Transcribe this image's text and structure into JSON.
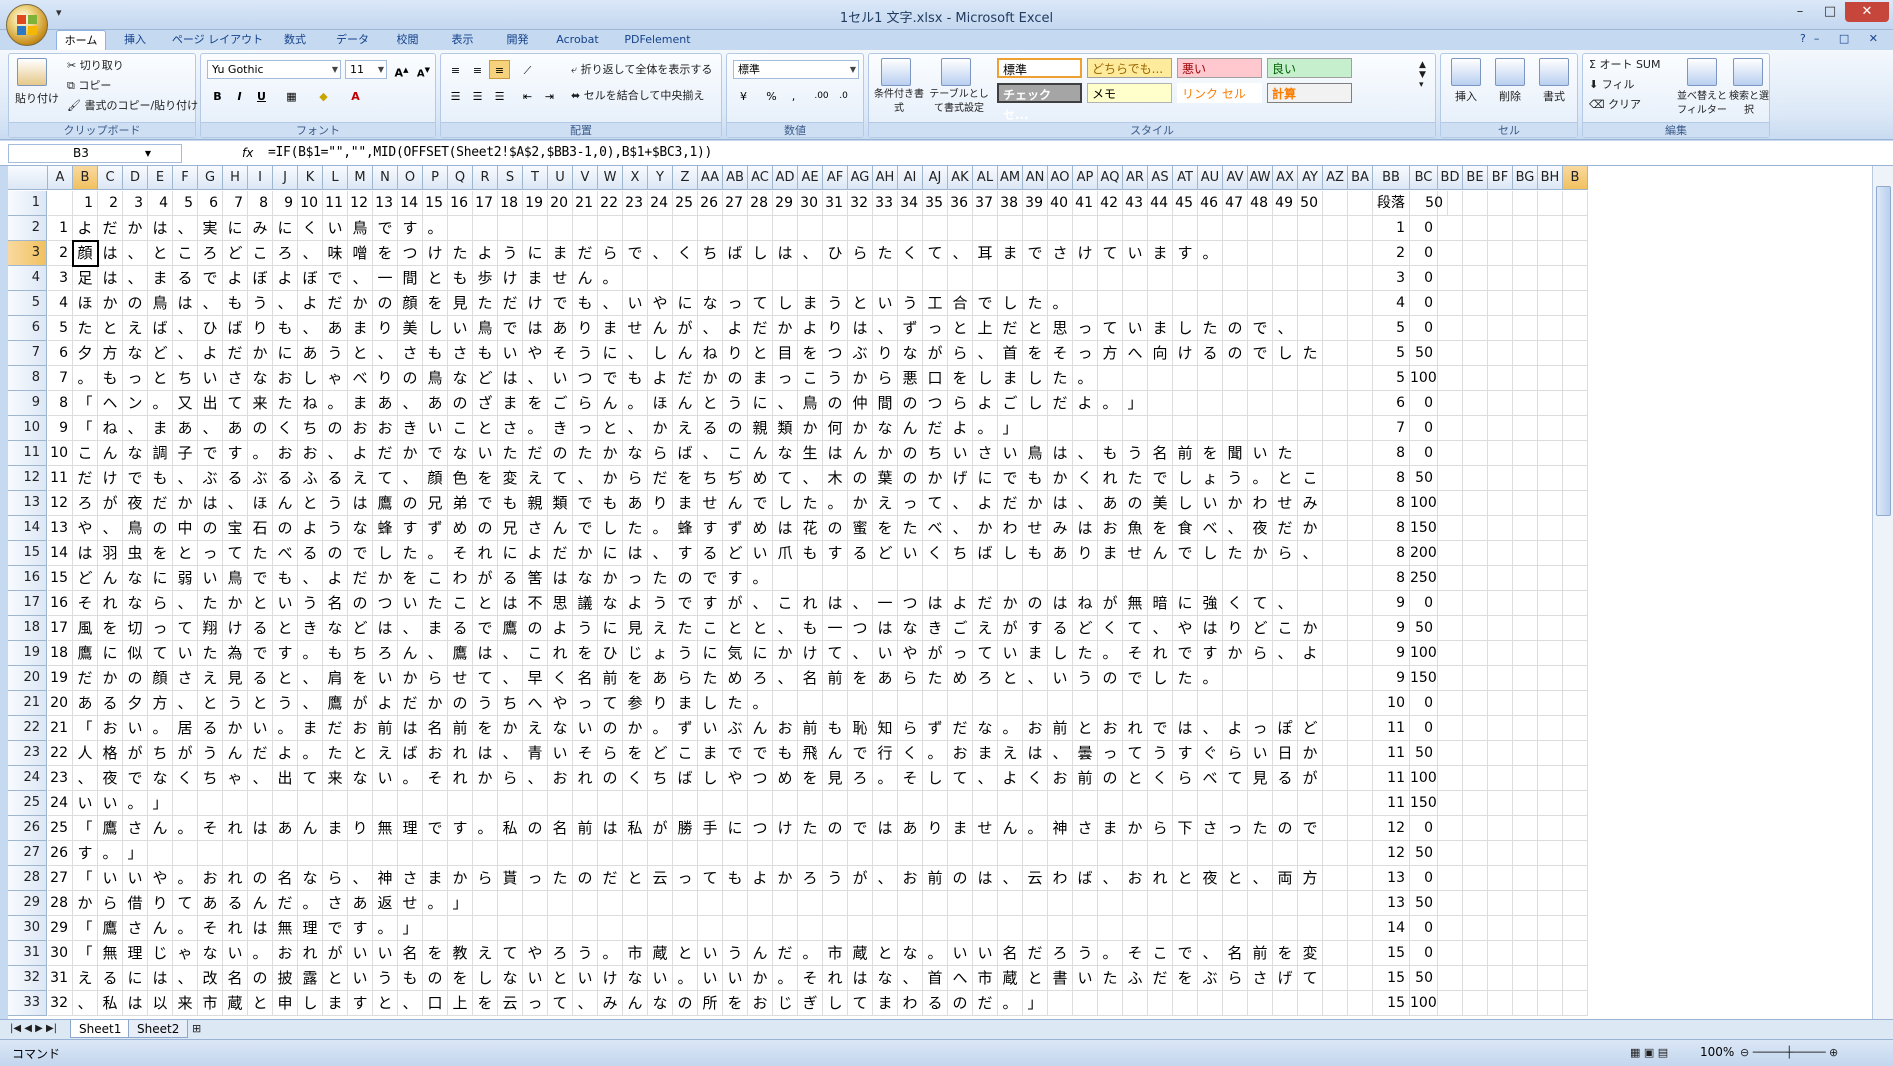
{
  "window": {
    "title": "1セル1 文字.xlsx - Microsoft Excel",
    "min": "–",
    "max": "□",
    "close": "✕"
  },
  "qat": "▾",
  "tabs": [
    "ホーム",
    "挿入",
    "ページ レイアウト",
    "数式",
    "データ",
    "校閲",
    "表示",
    "開発",
    "Acrobat",
    "PDFelement"
  ],
  "ribbon": {
    "clipboard": {
      "label": "クリップボード",
      "paste": "貼り付け",
      "cut": "切り取り",
      "copy": "コピー",
      "format_paint": "書式のコピー/貼り付け"
    },
    "font": {
      "label": "フォント",
      "name": "Yu Gothic",
      "size": "11",
      "bold": "B",
      "italic": "I",
      "underline": "U"
    },
    "align": {
      "label": "配置",
      "wrap": "折り返して全体を表示する",
      "merge": "セルを結合して中央揃え"
    },
    "number": {
      "label": "数値",
      "format": "標準",
      "percent": "%",
      "comma": ","
    },
    "styles": {
      "label": "スタイル",
      "cond": "条件付き書式",
      "table": "テーブルとして書式設定",
      "s1": "標準",
      "s2": "どちらでも...",
      "s3": "悪い",
      "s4": "良い",
      "s5": "チェック セ...",
      "s6": "メモ",
      "s7": "リンク セル",
      "s8": "計算"
    },
    "cells": {
      "label": "セル",
      "insert": "挿入",
      "delete": "削除",
      "format": "書式"
    },
    "edit": {
      "label": "編集",
      "autosum": "オート SUM",
      "fill": "フィル",
      "clear": "クリア",
      "sort": "並べ替えとフィルター",
      "find": "検索と選択"
    }
  },
  "formula_bar": {
    "name": "B3",
    "fx": "fx",
    "formula": "=IF(B$1=\"\",\"\",MID(OFFSET(Sheet2!$A$2,$BB3-1,0),B$1+$BC3,1))"
  },
  "columns": [
    "A",
    "B",
    "C",
    "D",
    "E",
    "F",
    "G",
    "H",
    "I",
    "J",
    "K",
    "L",
    "M",
    "N",
    "O",
    "P",
    "Q",
    "R",
    "S",
    "T",
    "U",
    "V",
    "W",
    "X",
    "Y",
    "Z",
    "AA",
    "AB",
    "AC",
    "AD",
    "AE",
    "AF",
    "AG",
    "AH",
    "AI",
    "AJ",
    "AK",
    "AL",
    "AM",
    "AN",
    "AO",
    "AP",
    "AQ",
    "AR",
    "AS",
    "AT",
    "AU",
    "AV",
    "AW",
    "AX",
    "AY",
    "AZ",
    "BA",
    "BB",
    "BC",
    "BD",
    "BE",
    "BF",
    "BG",
    "BH",
    "B"
  ],
  "row1": {
    "nums": [
      "1",
      "2",
      "3",
      "4",
      "5",
      "6",
      "7",
      "8",
      "9",
      "10",
      "11",
      "12",
      "13",
      "14",
      "15",
      "16",
      "17",
      "18",
      "19",
      "20",
      "21",
      "22",
      "23",
      "24",
      "25",
      "26",
      "27",
      "28",
      "29",
      "30",
      "31",
      "32",
      "33",
      "34",
      "35",
      "36",
      "37",
      "38",
      "39",
      "40",
      "41",
      "42",
      "43",
      "44",
      "45",
      "46",
      "47",
      "48",
      "49",
      "50"
    ],
    "bb": "段落",
    "bc": "50"
  },
  "rows": [
    {
      "a": "1",
      "t": "よだかは、実にみにくい鳥です。",
      "bb": "1",
      "bc": "0"
    },
    {
      "a": "2",
      "t": "顔は、ところどころ、味噌をつけたようにまだらで、くちばしは、ひらたくて、耳までさけています。",
      "bb": "2",
      "bc": "0"
    },
    {
      "a": "3",
      "t": "足は、まるでよぼよぼで、一間とも歩けません。",
      "bb": "3",
      "bc": "0"
    },
    {
      "a": "4",
      "t": "ほかの鳥は、もう、よだかの顔を見ただけでも、いやになってしまうという工合でした。",
      "bb": "4",
      "bc": "0"
    },
    {
      "a": "5",
      "t": "たとえば、ひばりも、あまり美しい鳥ではありませんが、よだかよりは、ずっと上だと思っていましたので、",
      "bb": "5",
      "bc": "0"
    },
    {
      "a": "6",
      "t": "夕方など、よだかにあうと、さもさもいやそうに、しんねりと目をつぶりながら、首をそっ方へ向けるのでした",
      "bb": "5",
      "bc": "50"
    },
    {
      "a": "7",
      "t": "。もっとちいさなおしゃべりの鳥などは、いつでもよだかのまっこうから悪口をしました。",
      "bb": "5",
      "bc": "100"
    },
    {
      "a": "8",
      "t": "「ヘン。又出て来たね。まあ、あのざまをごらん。ほんとうに、鳥の仲間のつらよごしだよ。」",
      "bb": "6",
      "bc": "0"
    },
    {
      "a": "9",
      "t": "「ね、まあ、あのくちのおおきいことさ。きっと、かえるの親類か何かなんだよ。」",
      "bb": "7",
      "bc": "0"
    },
    {
      "a": "10",
      "t": "こんな調子です。おお、よだかでないただのたかならば、こんな生はんかのちいさい鳥は、もう名前を聞いた",
      "bb": "8",
      "bc": "0"
    },
    {
      "a": "11",
      "t": "だけでも、ぶるぶるふるえて、顔色を変えて、からだをちぢめて、木の葉のかげにでもかくれたでしょう。とこ",
      "bb": "8",
      "bc": "50"
    },
    {
      "a": "12",
      "t": "ろが夜だかは、ほんとうは鷹の兄弟でも親類でもありませんでした。かえって、よだかは、あの美しいかわせみ",
      "bb": "8",
      "bc": "100"
    },
    {
      "a": "13",
      "t": "や、鳥の中の宝石のような蜂すずめの兄さんでした。蜂すずめは花の蜜をたべ、かわせみはお魚を食べ、夜だか",
      "bb": "8",
      "bc": "150"
    },
    {
      "a": "14",
      "t": "は羽虫をとってたべるのでした。それによだかには、するどい爪もするどいくちばしもありませんでしたから、",
      "bb": "8",
      "bc": "200"
    },
    {
      "a": "15",
      "t": "どんなに弱い鳥でも、よだかをこわがる筈はなかったのです。",
      "bb": "8",
      "bc": "250"
    },
    {
      "a": "16",
      "t": "それなら、たかという名のついたことは不思議なようですが、これは、一つはよだかのはねが無暗に強くて、",
      "bb": "9",
      "bc": "0"
    },
    {
      "a": "17",
      "t": "風を切って翔けるときなどは、まるで鷹のように見えたことと、も一つはなきごえがするどくて、やはりどこか",
      "bb": "9",
      "bc": "50"
    },
    {
      "a": "18",
      "t": "鷹に似ていた為です。もちろん、鷹は、これをひじょうに気にかけて、いやがっていました。それですから、よ",
      "bb": "9",
      "bc": "100"
    },
    {
      "a": "19",
      "t": "だかの顔さえ見ると、肩をいからせて、早く名前をあらためろ、名前をあらためろと、いうのでした。",
      "bb": "9",
      "bc": "150"
    },
    {
      "a": "20",
      "t": "ある夕方、とうとう、鷹がよだかのうちへやって参りました。",
      "bb": "10",
      "bc": "0"
    },
    {
      "a": "21",
      "t": "「おい。居るかい。まだお前は名前をかえないのか。ずいぶんお前も恥知らずだな。お前とおれでは、よっぽど",
      "bb": "11",
      "bc": "0"
    },
    {
      "a": "22",
      "t": "人格がちがうんだよ。たとえばおれは、青いそらをどこまででも飛んで行く。おまえは、曇ってうすぐらい日か",
      "bb": "11",
      "bc": "50"
    },
    {
      "a": "23",
      "t": "、夜でなくちゃ、出て来ない。それから、おれのくちばしやつめを見ろ。そして、よくお前のとくらべて見るが",
      "bb": "11",
      "bc": "100"
    },
    {
      "a": "24",
      "t": "いい。」",
      "bb": "11",
      "bc": "150"
    },
    {
      "a": "25",
      "t": "「鷹さん。それはあんまり無理です。私の名前は私が勝手につけたのではありません。神さまから下さったので",
      "bb": "12",
      "bc": "0"
    },
    {
      "a": "26",
      "t": "す。」",
      "bb": "12",
      "bc": "50"
    },
    {
      "a": "27",
      "t": "「いいや。おれの名なら、神さまから貰ったのだと云ってもよかろうが、お前のは、云わば、おれと夜と、両方",
      "bb": "13",
      "bc": "0"
    },
    {
      "a": "28",
      "t": "から借りてあるんだ。さあ返せ。」",
      "bb": "13",
      "bc": "50"
    },
    {
      "a": "29",
      "t": "「鷹さん。それは無理です。」",
      "bb": "14",
      "bc": "0"
    },
    {
      "a": "30",
      "t": "「無理じゃない。おれがいい名を教えてやろう。市蔵というんだ。市蔵とな。いい名だろう。そこで、名前を変",
      "bb": "15",
      "bc": "0"
    },
    {
      "a": "31",
      "t": "えるには、改名の披露というものをしないといけない。いいか。それはな、首へ市蔵と書いたふだをぶらさげて",
      "bb": "15",
      "bc": "50"
    },
    {
      "a": "32",
      "t": "、私は以来市蔵と申しますと、口上を云って、みんなの所をおじぎしてまわるのだ。」",
      "bb": "15",
      "bc": "100"
    }
  ],
  "sheets": [
    "Sheet1",
    "Sheet2"
  ],
  "status": {
    "mode": "コマンド",
    "zoom": "100%"
  }
}
